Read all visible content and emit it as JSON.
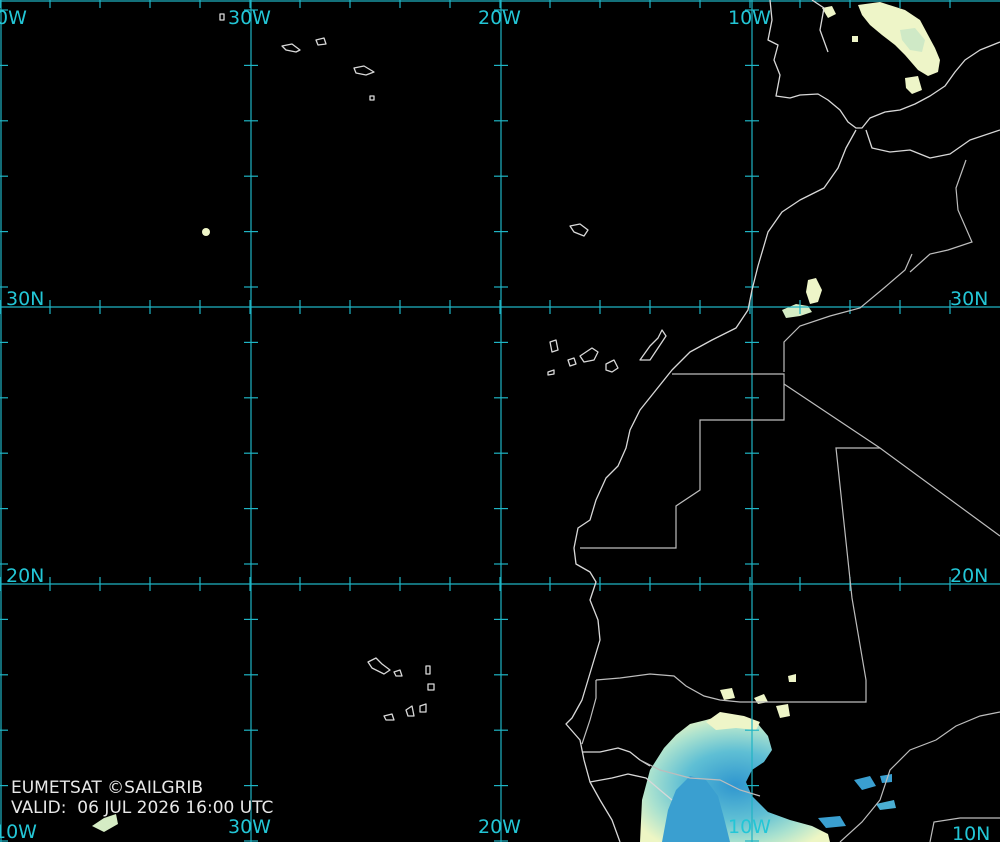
{
  "map": {
    "credit": "EUMETSAT ©SAILGRIB",
    "valid_prefix": "VALID:",
    "valid_time": "06 JUL 2026 16:00 UTC",
    "longitude_labels_top": [
      "0W",
      "30W",
      "20W",
      "10W"
    ],
    "longitude_labels_bottom": [
      "10W",
      "30W",
      "20W",
      "10W",
      "10N"
    ],
    "latitude_labels_left": [
      "30N",
      "20N"
    ],
    "latitude_labels_right": [
      "30N",
      "20N"
    ],
    "colors": {
      "background": "#000000",
      "grid": "#1fb4c4",
      "grid_label": "#23c6d6",
      "coastline": "#d8d8d8",
      "cloud_light": "#f2f7c8",
      "cloud_mid": "#8ed6d4",
      "cloud_dense": "#3a9fd0"
    }
  }
}
